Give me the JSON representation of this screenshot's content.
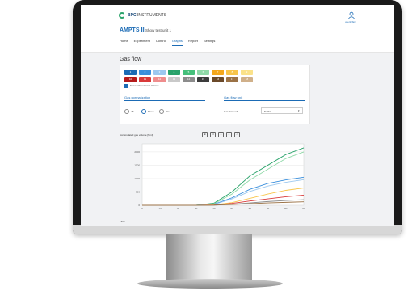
{
  "app": {
    "brand_bold": "BPC",
    "brand_rest": " INSTRUMENTS",
    "title": "AMPTS III",
    "subtitle": "Show test unit 1",
    "user_label": "user@bpc"
  },
  "nav": {
    "items": [
      {
        "label": "Home"
      },
      {
        "label": "Experiment"
      },
      {
        "label": "Control"
      },
      {
        "label": "Graphs",
        "active": true
      },
      {
        "label": "Report"
      },
      {
        "label": "Settings"
      }
    ]
  },
  "gas": {
    "title": "Gas flow",
    "show_legend_label": "Show information / all lines"
  },
  "chips_row1": [
    {
      "label": "1",
      "color": "#1b6bb5"
    },
    {
      "label": "2",
      "color": "#3a8fdc"
    },
    {
      "label": "3",
      "color": "#9cc8ef"
    },
    {
      "label": "4",
      "color": "#2aa36b"
    },
    {
      "label": "5",
      "color": "#46c07b"
    },
    {
      "label": "6",
      "color": "#8fd9a8"
    },
    {
      "label": "7",
      "color": "#f4a81d"
    },
    {
      "label": "8",
      "color": "#f8c54a"
    },
    {
      "label": "9",
      "color": "#fbe28a"
    }
  ],
  "chips_row2": [
    {
      "label": "10",
      "color": "#b51b1b"
    },
    {
      "label": "11",
      "color": "#d93a3a"
    },
    {
      "label": "12",
      "color": "#ef8d8d"
    },
    {
      "label": "13",
      "color": "#c9c9c9"
    },
    {
      "label": "14",
      "color": "#8c8c8c"
    },
    {
      "label": "15",
      "color": "#3c3c3c"
    },
    {
      "label": "16",
      "color": "#6b4a2a"
    },
    {
      "label": "17",
      "color": "#9b7246"
    },
    {
      "label": "18",
      "color": "#d0b08a"
    }
  ],
  "normalization": {
    "title": "Gas normalization",
    "options": [
      {
        "label": "off"
      },
      {
        "label": "Fixed"
      },
      {
        "label": "Var"
      }
    ]
  },
  "unit": {
    "title": "Gas flow unit",
    "label": "Gas flow unit",
    "value": "NmlN"
  },
  "chart": {
    "title": "Accumulated gas volume [Nml]",
    "x_label": "Time",
    "tools": [
      "⊕",
      "⊡",
      "+",
      "−",
      "⌂"
    ]
  },
  "chart_data": {
    "type": "line",
    "title": "Accumulated gas volume [Nml]",
    "xlabel": "Time",
    "ylabel": "",
    "x": [
      0,
      10,
      20,
      30,
      40,
      50,
      60,
      70,
      80,
      90
    ],
    "xlim": [
      0,
      90
    ],
    "ylim": [
      0,
      2300
    ],
    "yticks": [
      0,
      500,
      1000,
      1500,
      2000
    ],
    "xticks": [
      0,
      10,
      20,
      30,
      40,
      50,
      60,
      70,
      80,
      90
    ],
    "grid": true,
    "series": [
      {
        "color": "#2aa36b",
        "values": [
          0,
          0,
          0,
          0,
          80,
          500,
          1100,
          1500,
          1900,
          2150
        ]
      },
      {
        "color": "#8fd9a8",
        "values": [
          0,
          0,
          0,
          0,
          60,
          420,
          950,
          1350,
          1750,
          2000
        ]
      },
      {
        "color": "#3a8fdc",
        "values": [
          0,
          0,
          0,
          0,
          40,
          280,
          600,
          820,
          950,
          1050
        ]
      },
      {
        "color": "#9cc8ef",
        "values": [
          0,
          0,
          0,
          0,
          30,
          240,
          520,
          720,
          860,
          960
        ]
      },
      {
        "color": "#f8c54a",
        "values": [
          0,
          0,
          0,
          0,
          15,
          100,
          260,
          420,
          560,
          650
        ]
      },
      {
        "color": "#d93a3a",
        "values": [
          0,
          0,
          0,
          0,
          10,
          70,
          160,
          240,
          320,
          380
        ]
      },
      {
        "color": "#8c8c8c",
        "values": [
          0,
          0,
          0,
          0,
          5,
          40,
          90,
          140,
          180,
          210
        ]
      },
      {
        "color": "#9b7246",
        "values": [
          0,
          0,
          0,
          0,
          5,
          30,
          60,
          90,
          110,
          130
        ]
      }
    ]
  }
}
